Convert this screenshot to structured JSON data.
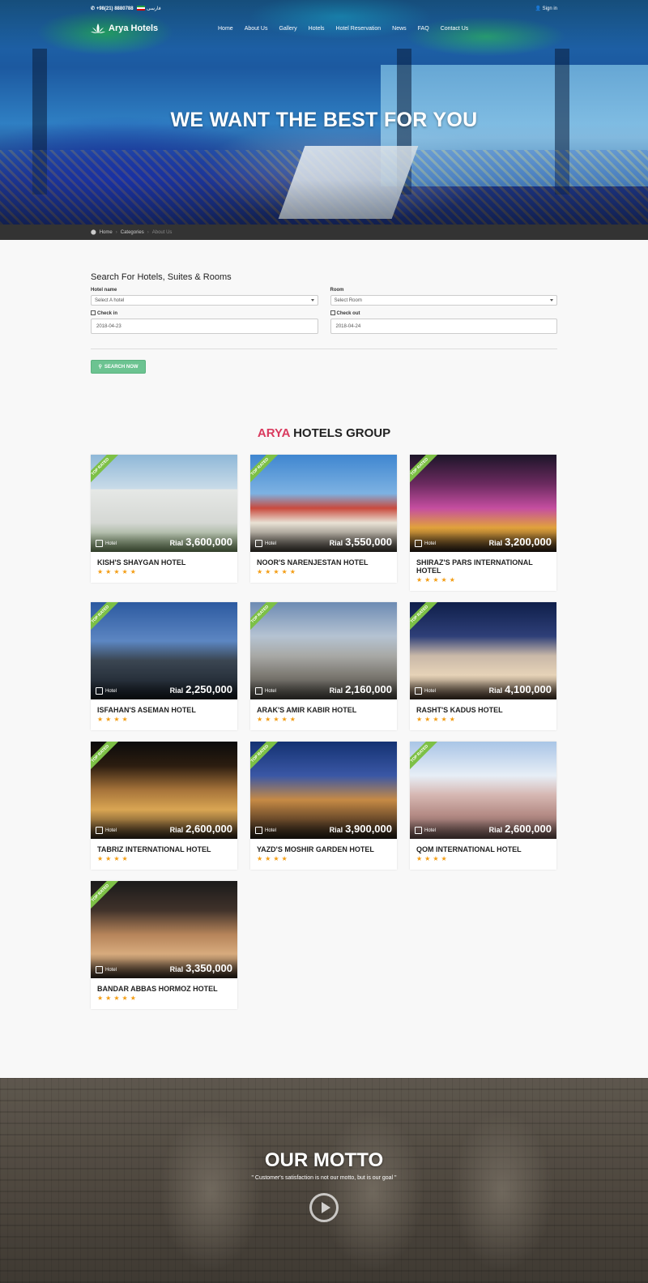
{
  "topbar": {
    "phone": "+98(21) 8880788",
    "language": "فارسی",
    "sign_in": "Sign in"
  },
  "brand": {
    "name": "Arya Hotels"
  },
  "nav": {
    "items": [
      "Home",
      "About Us",
      "Gallery",
      "Hotels",
      "Hotel Reservation",
      "News",
      "FAQ",
      "Contact Us"
    ]
  },
  "hero": {
    "title": "WE WANT THE BEST FOR YOU"
  },
  "breadcrumb": {
    "items": [
      "Home",
      "Categories",
      "About Us"
    ]
  },
  "search": {
    "title": "Search For Hotels, Suites & Rooms",
    "hotel_label": "Hotel name",
    "hotel_value": "Select A hotel",
    "room_label": "Room",
    "room_value": "Select Room",
    "checkin_label": "Check in",
    "checkin_value": "2018-04-23",
    "checkout_label": "Check out",
    "checkout_value": "2018-04-24",
    "button": "SEARCH NOW"
  },
  "group": {
    "title_accent": "ARYA",
    "title_rest": " HOTELS GROUP"
  },
  "card_labels": {
    "ribbon": "TOP RATED",
    "type": "Hotel",
    "currency": "Rial"
  },
  "hotels": [
    {
      "name": "KISH'S SHAYGAN HOTEL",
      "price": "3,600,000",
      "stars": "★★★★★"
    },
    {
      "name": "NOOR'S NARENJESTAN HOTEL",
      "price": "3,550,000",
      "stars": "★★★★★"
    },
    {
      "name": "SHIRAZ'S PARS INTERNATIONAL HOTEL",
      "price": "3,200,000",
      "stars": "★★★★★"
    },
    {
      "name": "ISFAHAN'S ASEMAN HOTEL",
      "price": "2,250,000",
      "stars": "★★★★"
    },
    {
      "name": "ARAK'S AMIR KABIR HOTEL",
      "price": "2,160,000",
      "stars": "★★★★★"
    },
    {
      "name": "RASHT'S KADUS HOTEL",
      "price": "4,100,000",
      "stars": "★★★★★"
    },
    {
      "name": "TABRIZ INTERNATIONAL HOTEL",
      "price": "2,600,000",
      "stars": "★★★★"
    },
    {
      "name": "YAZD'S MOSHIR GARDEN HOTEL",
      "price": "3,900,000",
      "stars": "★★★★"
    },
    {
      "name": "QOM INTERNATIONAL HOTEL",
      "price": "2,600,000",
      "stars": "★★★★"
    },
    {
      "name": "BANDAR ABBAS HORMOZ HOTEL",
      "price": "3,350,000",
      "stars": "★★★★★"
    }
  ],
  "motto": {
    "title": "OUR MOTTO",
    "text": "\" Customer's satisfaction is not our motto, but is our goal \""
  },
  "colors": {
    "accent": "#d93a5e",
    "button": "#6cc391",
    "ribbon": "#7dc046",
    "star": "#f39c12",
    "breadcrumb_bg": "#333333"
  }
}
